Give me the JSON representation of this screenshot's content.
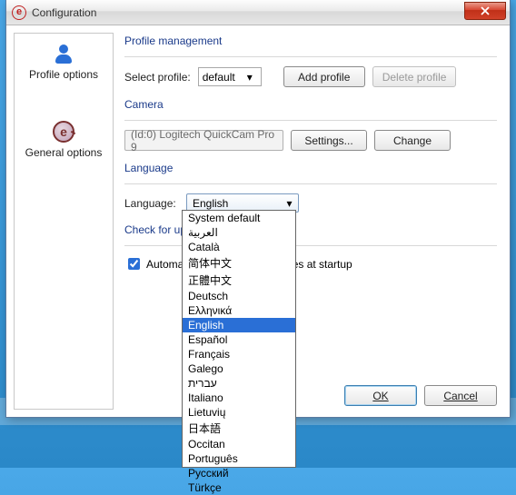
{
  "window": {
    "title": "Configuration"
  },
  "sidebar": {
    "items": [
      {
        "label": "Profile options"
      },
      {
        "label": "General options"
      }
    ]
  },
  "profile": {
    "group_title": "Profile management",
    "select_label": "Select profile:",
    "selected_profile": "default",
    "add_button": "Add profile",
    "delete_button": "Delete profile"
  },
  "camera": {
    "group_title": "Camera",
    "device_text": "(Id:0) Logitech QuickCam Pro 9",
    "settings_button": "Settings...",
    "change_button": "Change"
  },
  "language": {
    "group_title": "Language",
    "label": "Language:",
    "selected": "English",
    "options": [
      "System default",
      "العربية",
      "Català",
      "简体中文",
      "正體中文",
      "Deutsch",
      "Ελληνικά",
      "English",
      "Español",
      "Français",
      "Galego",
      "עברית",
      "Italiano",
      "Lietuvių",
      "日本語",
      "Occitan",
      "Português",
      "Русский",
      "Türkçe"
    ]
  },
  "updates": {
    "group_title": "Check for updates",
    "checkbox_label_before": "Automati",
    "checkbox_label_after": "tes at startup",
    "checked": true
  },
  "footer": {
    "ok": "OK",
    "cancel": "Cancel"
  }
}
